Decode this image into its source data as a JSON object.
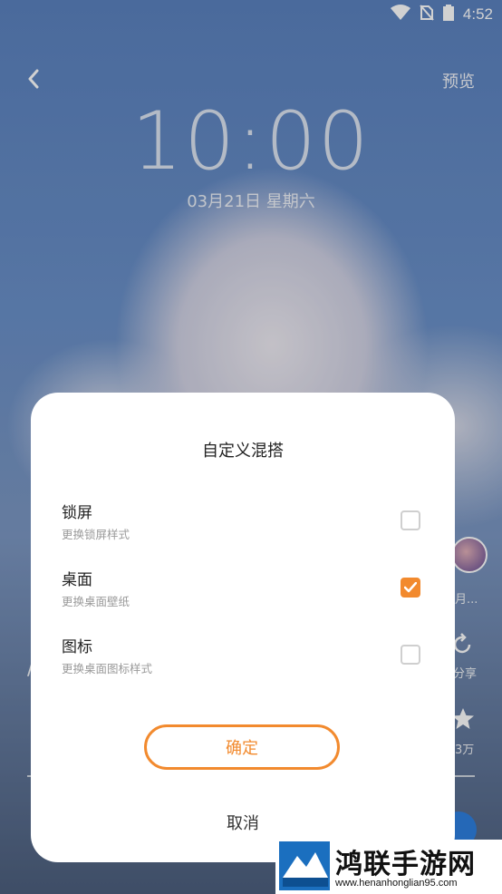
{
  "status_bar": {
    "time": "4:52",
    "icons": [
      "wifi-icon",
      "no-sim-icon",
      "battery-icon"
    ]
  },
  "top_bar": {
    "back_icon": "chevron-left-icon",
    "preview_label": "预览"
  },
  "lockscreen": {
    "clock": "10:00",
    "date": "03月21日 星期六"
  },
  "side_panel": {
    "avatar_caption": "月...",
    "share_label": "分享",
    "favorite_count": "3万",
    "left_partial_text": "/"
  },
  "dialog": {
    "title": "自定义混搭",
    "options": [
      {
        "title": "锁屏",
        "subtitle": "更换锁屏样式",
        "checked": false
      },
      {
        "title": "桌面",
        "subtitle": "更换桌面壁纸",
        "checked": true
      },
      {
        "title": "图标",
        "subtitle": "更换桌面图标样式",
        "checked": false
      }
    ],
    "confirm_label": "确定",
    "cancel_label": "取消"
  },
  "watermark": {
    "name": "鸿联手游网",
    "url": "www.henanhonglian95.com"
  },
  "colors": {
    "accent": "#f28a2e",
    "checkbox_border": "#cfcfcf",
    "subtitle": "#9a9a9a"
  }
}
